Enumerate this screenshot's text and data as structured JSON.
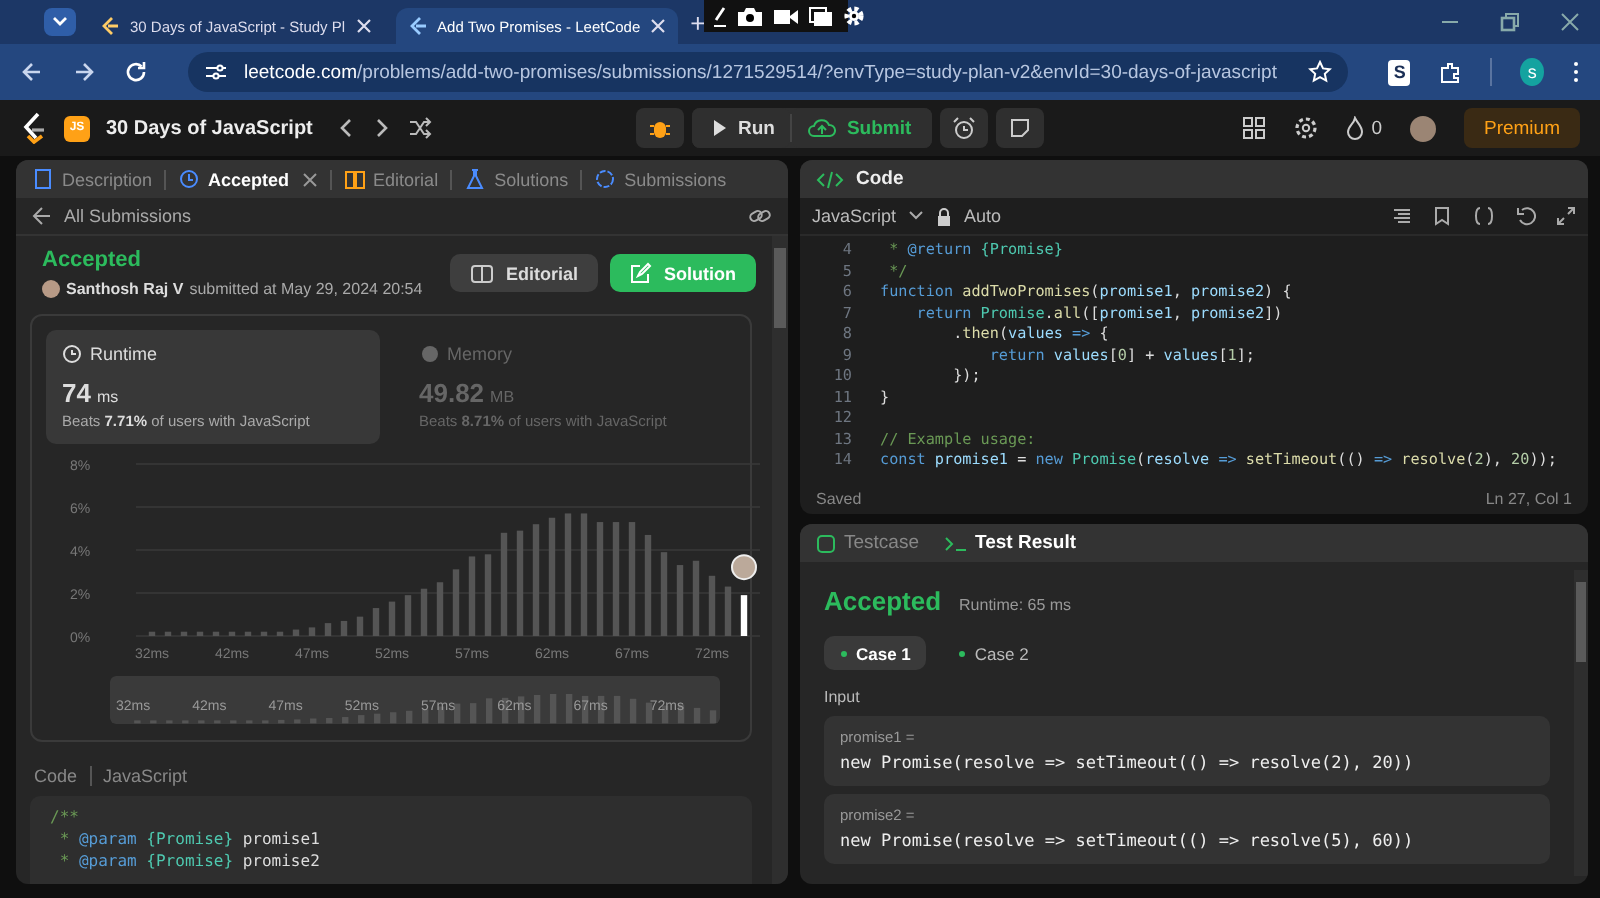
{
  "browser": {
    "tabs": [
      {
        "title": "30 Days of JavaScript - Study Pl",
        "selected": false
      },
      {
        "title": "Add Two Promises - LeetCode",
        "selected": true
      }
    ],
    "new_tab": "+",
    "url_host": "leetcode.com",
    "url_path": "/problems/add-two-promises/submissions/1271529514/?envType=study-plan-v2&envId=30-days-of-javascript",
    "extension_label": "S",
    "profile_initial": "s"
  },
  "nav": {
    "plan_badge": "JS",
    "study_plan": "30 Days of JavaScript",
    "run": "Run",
    "submit": "Submit",
    "streak": "0",
    "premium": "Premium"
  },
  "left_tabs": [
    {
      "label": "Description",
      "selected": false,
      "closable": false
    },
    {
      "label": "Accepted",
      "selected": true,
      "closable": true
    },
    {
      "label": "Editorial",
      "selected": false,
      "closable": false
    },
    {
      "label": "Solutions",
      "selected": false,
      "closable": false
    },
    {
      "label": "Submissions",
      "selected": false,
      "closable": false
    }
  ],
  "submission": {
    "back": "All Submissions",
    "status": "Accepted",
    "author": "Santhosh Raj V",
    "submitted": "submitted at May 29, 2024 20:54",
    "buttons": [
      {
        "label": "Editorial",
        "kind": "secondary"
      },
      {
        "label": "Solution",
        "kind": "primary"
      }
    ]
  },
  "stats": [
    {
      "label": "Runtime",
      "value": "74",
      "unit": "ms",
      "beats": "Beats **7.71%** of users with JavaScript",
      "selected": true
    },
    {
      "label": "Memory",
      "value": "49.82",
      "unit": "MB",
      "beats": "Beats **8.71%** of users with JavaScript",
      "selected": false
    }
  ],
  "chart_data": {
    "type": "bar",
    "ylim": [
      0,
      8
    ],
    "grid": true,
    "categories": [
      "32ms",
      null,
      null,
      null,
      null,
      "42ms",
      null,
      null,
      null,
      null,
      "47ms",
      null,
      null,
      null,
      null,
      "52ms",
      null,
      null,
      null,
      null,
      "57ms",
      null,
      null,
      null,
      null,
      "62ms",
      null,
      null,
      null,
      null,
      "67ms",
      null,
      null,
      null,
      null,
      "72ms",
      null,
      null
    ],
    "stacked": true,
    "series": [
      {
        "color": "#555555",
        "values": [
          0.2,
          0.2,
          0.2,
          0.2,
          0.2,
          0.2,
          0.2,
          0.2,
          0.2,
          0.3,
          0.4,
          0.6,
          0.7,
          0.9,
          1.3,
          1.6,
          1.9,
          2.2,
          2.5,
          3.1,
          3.7,
          3.8,
          4.8,
          4.9,
          5.2,
          5.5,
          5.7,
          5.7,
          5.3,
          5.3,
          5.3,
          4.7,
          3.9,
          3.3,
          3.5,
          2.8,
          2.3,
          null
        ]
      },
      {
        "color": "#ffffff",
        "values": [
          null,
          null,
          null,
          null,
          null,
          null,
          null,
          null,
          null,
          null,
          null,
          null,
          null,
          null,
          null,
          null,
          null,
          null,
          null,
          null,
          null,
          null,
          null,
          null,
          null,
          null,
          null,
          null,
          null,
          null,
          null,
          null,
          null,
          null,
          null,
          null,
          null,
          1.9
        ]
      }
    ],
    "yticks": [
      {
        "value": 0,
        "label": "0%"
      },
      {
        "value": 2,
        "label": "2%"
      },
      {
        "value": 4,
        "label": "4%"
      },
      {
        "value": 6,
        "label": "6%"
      },
      {
        "value": 8,
        "label": "8%"
      }
    ]
  },
  "range_slider": {
    "level": 1,
    "labels": [
      "32ms",
      "42ms",
      "47ms",
      "52ms",
      "57ms",
      "62ms",
      "67ms",
      "72ms"
    ]
  },
  "submitted_code": {
    "title": "Code",
    "language": "JavaScript",
    "lines": [
      {
        "tokens": [
          {
            "kind": "c",
            "text": "/**"
          }
        ]
      },
      {
        "tokens": [
          {
            "kind": "c",
            "text": " * "
          },
          {
            "kind": "tag",
            "text": "@param"
          },
          {
            "kind": "type",
            "text": " {Promise}"
          },
          {
            "kind": "p",
            "text": " promise1"
          }
        ]
      },
      {
        "tokens": [
          {
            "kind": "c",
            "text": " * "
          },
          {
            "kind": "tag",
            "text": "@param"
          },
          {
            "kind": "type",
            "text": " {Promise}"
          },
          {
            "kind": "p",
            "text": " promise2"
          }
        ]
      }
    ]
  },
  "editor": {
    "title": "Code",
    "language": "JavaScript",
    "mode": "Auto",
    "status": "Saved",
    "cursor": "Ln 27, Col 1",
    "lines": [
      {
        "n": "4",
        "tokens": [
          {
            "kind": "c",
            "text": " * "
          },
          {
            "kind": "tag",
            "text": "@return"
          },
          {
            "kind": "type",
            "text": " {Promise}"
          }
        ]
      },
      {
        "n": "5",
        "tokens": [
          {
            "kind": "c",
            "text": " */"
          }
        ]
      },
      {
        "n": "6",
        "tokens": [
          {
            "kind": "kw",
            "text": "function"
          },
          {
            "kind": "fn",
            "text": " addTwoPromises"
          },
          {
            "kind": "p",
            "text": "("
          },
          {
            "kind": "v",
            "text": "promise1"
          },
          {
            "kind": "p",
            "text": ", "
          },
          {
            "kind": "v",
            "text": "promise2"
          },
          {
            "kind": "p",
            "text": ") {"
          }
        ]
      },
      {
        "n": "7",
        "tokens": [
          {
            "kind": "kw",
            "text": "    return"
          },
          {
            "kind": "type",
            "text": " Promise"
          },
          {
            "kind": "p",
            "text": "."
          },
          {
            "kind": "fn",
            "text": "all"
          },
          {
            "kind": "p",
            "text": "(["
          },
          {
            "kind": "v",
            "text": "promise1"
          },
          {
            "kind": "p",
            "text": ", "
          },
          {
            "kind": "v",
            "text": "promise2"
          },
          {
            "kind": "p",
            "text": "])"
          }
        ]
      },
      {
        "n": "8",
        "tokens": [
          {
            "kind": "p",
            "text": "        ."
          },
          {
            "kind": "fn",
            "text": "then"
          },
          {
            "kind": "p",
            "text": "("
          },
          {
            "kind": "v",
            "text": "values"
          },
          {
            "kind": "kw",
            "text": " =>"
          },
          {
            "kind": "p",
            "text": " {"
          }
        ]
      },
      {
        "n": "9",
        "tokens": [
          {
            "kind": "kw",
            "text": "            return"
          },
          {
            "kind": "v",
            "text": " values"
          },
          {
            "kind": "p",
            "text": "["
          },
          {
            "kind": "num",
            "text": "0"
          },
          {
            "kind": "p",
            "text": "] + "
          },
          {
            "kind": "v",
            "text": "values"
          },
          {
            "kind": "p",
            "text": "["
          },
          {
            "kind": "num",
            "text": "1"
          },
          {
            "kind": "p",
            "text": "];"
          }
        ]
      },
      {
        "n": "10",
        "tokens": [
          {
            "kind": "p",
            "text": "        });"
          }
        ]
      },
      {
        "n": "11",
        "tokens": [
          {
            "kind": "p",
            "text": "}"
          }
        ]
      },
      {
        "n": "12"
      },
      {
        "n": "13",
        "tokens": [
          {
            "kind": "c",
            "text": "// Example usage:"
          }
        ]
      },
      {
        "n": "14",
        "tokens": [
          {
            "kind": "kw",
            "text": "const"
          },
          {
            "kind": "v",
            "text": " promise1"
          },
          {
            "kind": "p",
            "text": " = "
          },
          {
            "kind": "kw",
            "text": "new"
          },
          {
            "kind": "type",
            "text": " Promise"
          },
          {
            "kind": "p",
            "text": "("
          },
          {
            "kind": "v",
            "text": "resolve"
          },
          {
            "kind": "kw",
            "text": " =>"
          },
          {
            "kind": "fn",
            "text": " setTimeout"
          },
          {
            "kind": "p",
            "text": "(() "
          },
          {
            "kind": "kw",
            "text": "=>"
          },
          {
            "kind": "fn",
            "text": " resolve"
          },
          {
            "kind": "p",
            "text": "("
          },
          {
            "kind": "num",
            "text": "2"
          },
          {
            "kind": "p",
            "text": "), "
          },
          {
            "kind": "num",
            "text": "20"
          },
          {
            "kind": "p",
            "text": "));"
          }
        ]
      }
    ]
  },
  "result": {
    "tabs": [
      {
        "label": "Testcase",
        "selected": false
      },
      {
        "label": "Test Result",
        "selected": true
      }
    ],
    "status": "Accepted",
    "runtime": "Runtime: 65 ms",
    "cases": [
      {
        "label": "Case 1",
        "selected": true
      },
      {
        "label": "Case 2",
        "selected": false
      }
    ],
    "input_label": "Input",
    "inputs": [
      {
        "name": "promise1 =",
        "value": "new Promise(resolve => setTimeout(() => resolve(2), 20))"
      },
      {
        "name": "promise2 =",
        "value": "new Promise(resolve => setTimeout(() => resolve(5), 60))"
      }
    ]
  }
}
